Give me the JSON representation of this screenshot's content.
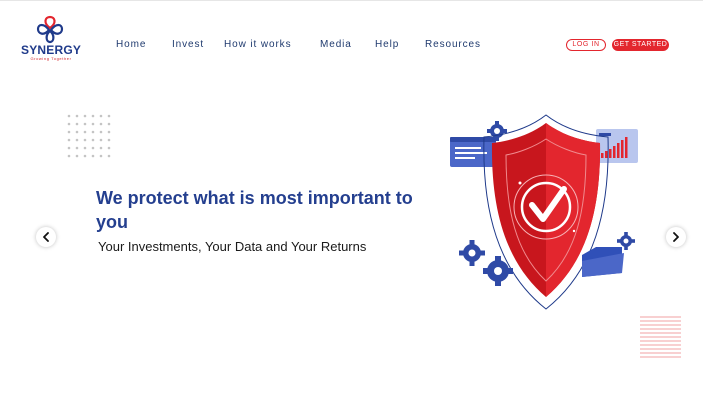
{
  "brand": {
    "name": "SYNERGY",
    "tagline": "Growing Together",
    "colors": {
      "primary": "#1f3a8a",
      "accent": "#e3262e"
    }
  },
  "nav": {
    "items": [
      {
        "label": "Home"
      },
      {
        "label": "Invest"
      },
      {
        "label": "How it works"
      },
      {
        "label": "Media"
      },
      {
        "label": "Help"
      },
      {
        "label": "Resources"
      }
    ]
  },
  "auth": {
    "login_label": "LOG IN",
    "get_started_label": "GET STARTED"
  },
  "hero": {
    "headline": "We protect what is most important to you",
    "subheadline": "Your Investments, Your Data and Your Returns",
    "illustration": "security-shield-illustration"
  },
  "carousel": {
    "prev_icon": "chevron-left-icon",
    "next_icon": "chevron-right-icon"
  }
}
